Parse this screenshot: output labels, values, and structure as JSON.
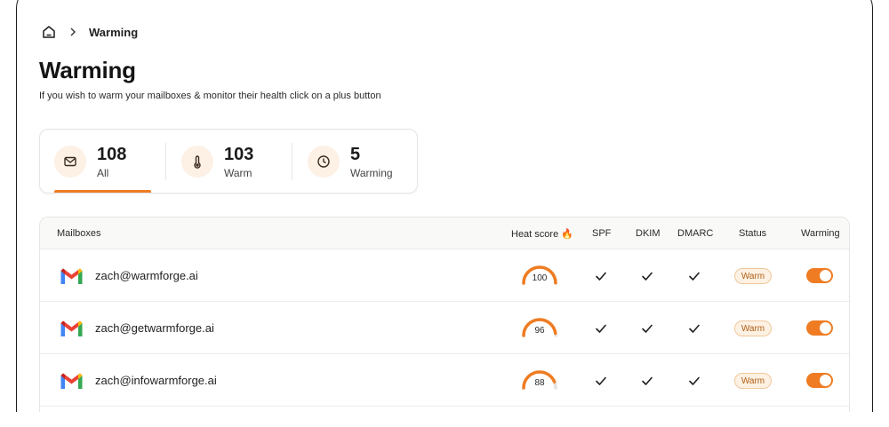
{
  "breadcrumb": {
    "current": "Warming"
  },
  "page": {
    "title": "Warming",
    "subtitle": "If you wish to warm your mailboxes & monitor their health click on a plus button"
  },
  "stats": [
    {
      "count": "108",
      "label": "All",
      "icon": "mail-icon"
    },
    {
      "count": "103",
      "label": "Warm",
      "icon": "thermometer-icon"
    },
    {
      "count": "5",
      "label": "Warming",
      "icon": "clock-icon"
    }
  ],
  "table": {
    "headers": {
      "mailboxes": "Mailboxes",
      "heat_score": "Heat score 🔥",
      "spf": "SPF",
      "dkim": "DKIM",
      "dmarc": "DMARC",
      "status": "Status",
      "warming": "Warming"
    },
    "rows": [
      {
        "email": "zach@warmforge.ai",
        "heat_score": 100,
        "spf": true,
        "dkim": true,
        "dmarc": true,
        "status": "Warm",
        "warming_on": true
      },
      {
        "email": "zach@getwarmforge.ai",
        "heat_score": 96,
        "spf": true,
        "dkim": true,
        "dmarc": true,
        "status": "Warm",
        "warming_on": true
      },
      {
        "email": "zach@infowarmforge.ai",
        "heat_score": 88,
        "spf": true,
        "dkim": true,
        "dmarc": true,
        "status": "Warm",
        "warming_on": true
      }
    ]
  },
  "colors": {
    "accent": "#ef7c22",
    "icon_bg": "#fdf0e5",
    "badge_bg": "#fdf1e3",
    "badge_text": "#b05d14"
  }
}
